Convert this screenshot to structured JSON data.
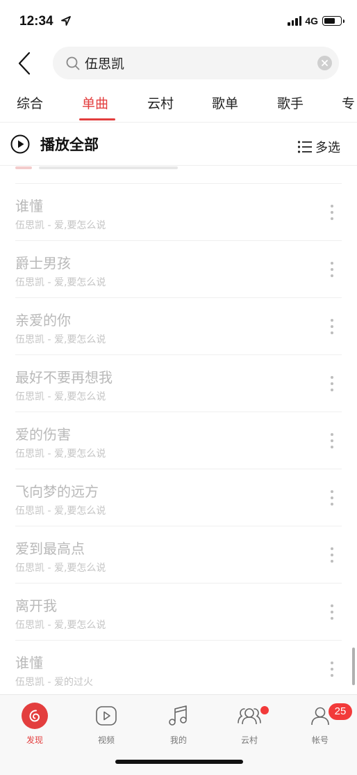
{
  "status_bar": {
    "time": "12:34",
    "network": "4G",
    "battery_level": 0.7,
    "location_icon": "location-arrow-icon"
  },
  "search": {
    "query": "伍思凯",
    "back_icon": "chevron-left-icon",
    "search_icon": "search-icon",
    "clear_icon": "clear-icon"
  },
  "tabs": [
    {
      "label": "综合",
      "active": false
    },
    {
      "label": "单曲",
      "active": true
    },
    {
      "label": "云村",
      "active": false
    },
    {
      "label": "歌单",
      "active": false
    },
    {
      "label": "歌手",
      "active": false
    },
    {
      "label": "专",
      "active": false
    }
  ],
  "play_all": {
    "label": "播放全部",
    "multi_select_label": "多选",
    "play_icon": "play-circle-icon",
    "list_icon": "list-icon"
  },
  "songs": [
    {
      "title": "谁懂",
      "subtitle": "伍思凯 - 爱,要怎么说"
    },
    {
      "title": "爵士男孩",
      "subtitle": "伍思凯 - 爱,要怎么说"
    },
    {
      "title": "亲爱的你",
      "subtitle": "伍思凯 - 爱,要怎么说"
    },
    {
      "title": "最好不要再想我",
      "subtitle": "伍思凯 - 爱,要怎么说"
    },
    {
      "title": "爱的伤害",
      "subtitle": "伍思凯 - 爱,要怎么说"
    },
    {
      "title": "飞向梦的远方",
      "subtitle": "伍思凯 - 爱,要怎么说"
    },
    {
      "title": "爱到最高点",
      "subtitle": "伍思凯 - 爱,要怎么说"
    },
    {
      "title": "离开我",
      "subtitle": "伍思凯 - 爱,要怎么说"
    },
    {
      "title": "谁懂",
      "subtitle": "伍思凯 - 爱的过火"
    }
  ],
  "bottom_nav": [
    {
      "label": "发现",
      "icon": "discover-icon",
      "active": true
    },
    {
      "label": "视频",
      "icon": "video-icon",
      "active": false
    },
    {
      "label": "我的",
      "icon": "music-note-icon",
      "active": false
    },
    {
      "label": "云村",
      "icon": "community-icon",
      "active": false,
      "dot": true
    },
    {
      "label": "帐号",
      "icon": "account-icon",
      "active": false,
      "badge": "25"
    }
  ],
  "colors": {
    "accent": "#e33e3e",
    "muted_text": "#b9b9b9",
    "badge": "#f23a3a"
  }
}
